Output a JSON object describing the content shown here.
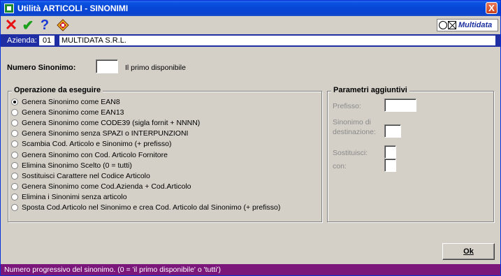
{
  "window": {
    "title": "Utilità ARTICOLI - SINONIMI",
    "close_glyph": "X"
  },
  "toolbar": {
    "cancel_glyph": "✕",
    "confirm_glyph": "✔",
    "help_glyph": "?",
    "brand_text": "Multidata"
  },
  "company": {
    "label": "Azienda:",
    "code": "01",
    "name": "MULTIDATA S.R.L."
  },
  "main": {
    "numero_sinonimo_label": "Numero Sinonimo:",
    "numero_sinonimo_value": "",
    "primo_disponibile": "Il primo disponibile"
  },
  "operazione": {
    "title": "Operazione da eseguire",
    "selected_index": 0,
    "options": [
      "Genera Sinonimo come EAN8",
      "Genera Sinonimo come EAN13",
      "Genera Sinonimo come CODE39 (sigla fornit + NNNN)",
      "Genera Sinonimo senza SPAZI o INTERPUNZIONI",
      "Scambia Cod. Articolo e Sinonimo (+ prefisso)",
      "Genera Sinonimo con Cod. Articolo Fornitore",
      "Elimina Sinonimo Scelto (0 = tutti)",
      "Sostituisci Carattere nel Codice Articolo",
      "Genera Sinonimo come Cod.Azienda + Cod.Articolo",
      "Elimina i Sinonimi senza articolo",
      "Sposta Cod.Articolo nel Sinonimo e crea Cod. Articolo dal Sinonimo (+ prefisso)"
    ]
  },
  "parametri": {
    "title": "Parametri aggiuntivi",
    "prefisso_label": "Prefisso:",
    "sinonimo_dest_label_1": "Sinonimo di",
    "sinonimo_dest_label_2": "destinazione:",
    "sostituisci_label": "Sostituisci:",
    "con_label": "con:",
    "prefisso_value": "",
    "sinonimo_dest_value": "",
    "sostituisci_value": "",
    "con_value": ""
  },
  "buttons": {
    "ok_label": "Ok"
  },
  "status": {
    "text": "Numero progressivo del sinonimo. (0 = 'il primo disponibile' o 'tutti')"
  },
  "colors": {
    "titlebar": "#0846d6",
    "company_bar": "#1f2fa3",
    "statusbar": "#7b167b",
    "background": "#d4d0c8"
  }
}
